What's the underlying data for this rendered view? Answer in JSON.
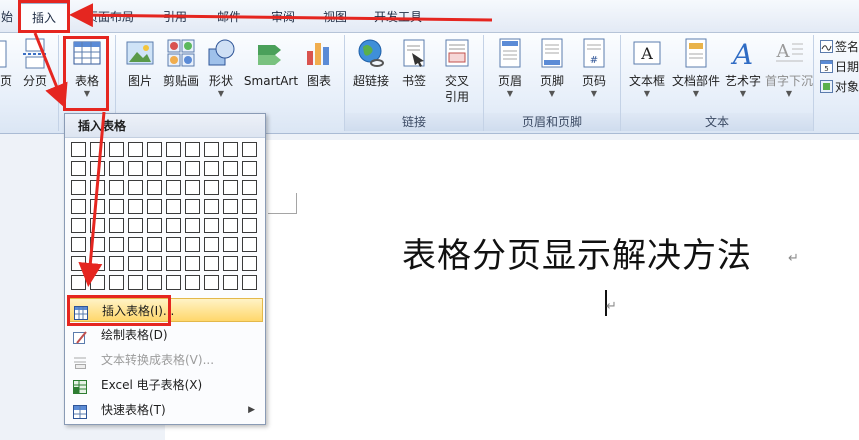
{
  "tabs": [
    {
      "label": "始",
      "active": false
    },
    {
      "label": "插入",
      "active": true
    },
    {
      "label": "页面布局",
      "active": false
    },
    {
      "label": "引用",
      "active": false
    },
    {
      "label": "邮件",
      "active": false
    },
    {
      "label": "审阅",
      "active": false
    },
    {
      "label": "视图",
      "active": false
    },
    {
      "label": "开发工具",
      "active": false
    }
  ],
  "ribbon": {
    "buttons": {
      "page": "页",
      "page_break": "分页",
      "table": "表格",
      "picture": "图片",
      "clipart": "剪贴画",
      "shapes": "形状",
      "smartart": "SmartArt",
      "chart": "图表",
      "hyperlink": "超链接",
      "bookmark": "书签",
      "crossref_line1": "交叉",
      "crossref_line2": "引用",
      "header": "页眉",
      "footer": "页脚",
      "page_number": "页码",
      "textbox": "文本框",
      "quickparts": "文档部件",
      "wordart": "艺术字",
      "dropcap": "首字下沉"
    },
    "small_buttons": {
      "signature": "签名",
      "datetime": "日期",
      "object": "对象"
    },
    "groups": {
      "links": "链接",
      "header_footer": "页眉和页脚",
      "text": "文本"
    }
  },
  "dropdown": {
    "header": "插入表格",
    "grid_cols": 10,
    "grid_rows": 8,
    "items": [
      {
        "label": "插入表格(I)...",
        "state": "highlighted"
      },
      {
        "label": "绘制表格(D)",
        "state": "normal"
      },
      {
        "label": "文本转换成表格(V)...",
        "state": "disabled"
      },
      {
        "label": "Excel 电子表格(X)",
        "state": "normal"
      },
      {
        "label": "快速表格(T)",
        "state": "normal",
        "submenu": true
      }
    ]
  },
  "document": {
    "title": "表格分页显示解决方法",
    "para_mark": "↵"
  },
  "colors": {
    "annotation_red": "#e52620",
    "highlight": "#ffd76b"
  }
}
